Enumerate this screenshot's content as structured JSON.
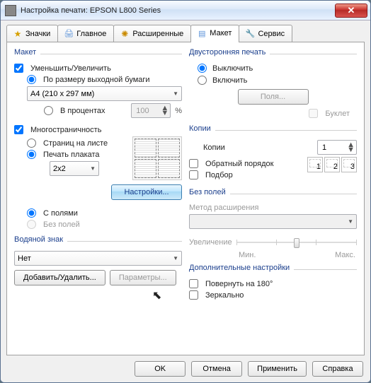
{
  "window_title": "Настройка печати: EPSON L800 Series",
  "tabs": {
    "t0": "Значки",
    "t1": "Главное",
    "t2": "Расширенные",
    "t3": "Макет",
    "t4": "Сервис"
  },
  "left": {
    "group_layout": "Макет",
    "cb_reduce": "Уменьшить/Увеличить",
    "rb_fit": "По размеру выходной бумаги",
    "paper_size": "A4 (210 x 297 мм)",
    "rb_percent": "В процентах",
    "percent_val": "100",
    "percent_sign": "%",
    "cb_multipage": "Многостраничность",
    "rb_pages": "Страниц на листе",
    "rb_poster": "Печать плаката",
    "poster_size": "2x2",
    "btn_settings": "Настройки...",
    "rb_with": "С полями",
    "rb_without": "Без полей",
    "group_wm": "Водяной знак",
    "wm_value": "Нет",
    "btn_addrem": "Добавить/Удалить...",
    "btn_params": "Параметры..."
  },
  "right": {
    "group_duplex": "Двусторонняя печать",
    "rb_off": "Выключить",
    "rb_on": "Включить",
    "btn_margins": "Поля...",
    "cb_booklet": "Буклет",
    "group_copies": "Копии",
    "lbl_copies": "Копии",
    "copies_val": "1",
    "cb_reverse": "Обратный порядок",
    "cb_collate": "Подбор",
    "page_nums": {
      "p1": "1",
      "p2": "2",
      "p3": "3"
    },
    "group_borderless": "Без полей",
    "lbl_method": "Метод расширения",
    "method_val": "",
    "lbl_enlarge": "Увеличение",
    "lbl_min": "Мин.",
    "lbl_max": "Макс.",
    "group_extra": "Дополнительные настройки",
    "cb_rotate": "Повернуть на  180°",
    "cb_mirror": "Зеркально"
  },
  "buttons": {
    "ok": "OK",
    "cancel": "Отмена",
    "apply": "Применить",
    "help": "Справка"
  }
}
